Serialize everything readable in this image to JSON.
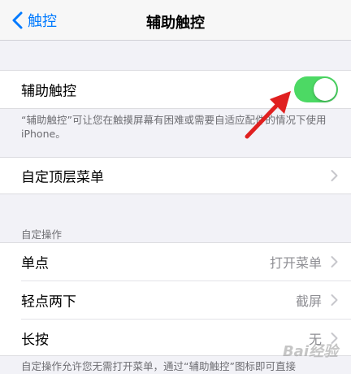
{
  "nav": {
    "back_label": "触控",
    "title": "辅助触控"
  },
  "assistive_touch": {
    "label": "辅助触控",
    "toggle_on": true,
    "footnote": "“辅助触控”可让您在触摸屏幕有困难或需要自适应配件的情况下使用iPhone。"
  },
  "top_menu": {
    "label": "自定顶层菜单"
  },
  "custom_actions": {
    "header": "自定操作",
    "items": [
      {
        "label": "单点",
        "value": "打开菜单"
      },
      {
        "label": "轻点两下",
        "value": "截屏"
      },
      {
        "label": "长按",
        "value": "无"
      }
    ],
    "footnote": "自定操作允许您无需打开菜单，通过“辅助触控”图标即可直接"
  },
  "watermark": "Bai经验",
  "colors": {
    "accent": "#007aff",
    "toggle_on": "#4cd964",
    "arrow": "#e02020"
  }
}
